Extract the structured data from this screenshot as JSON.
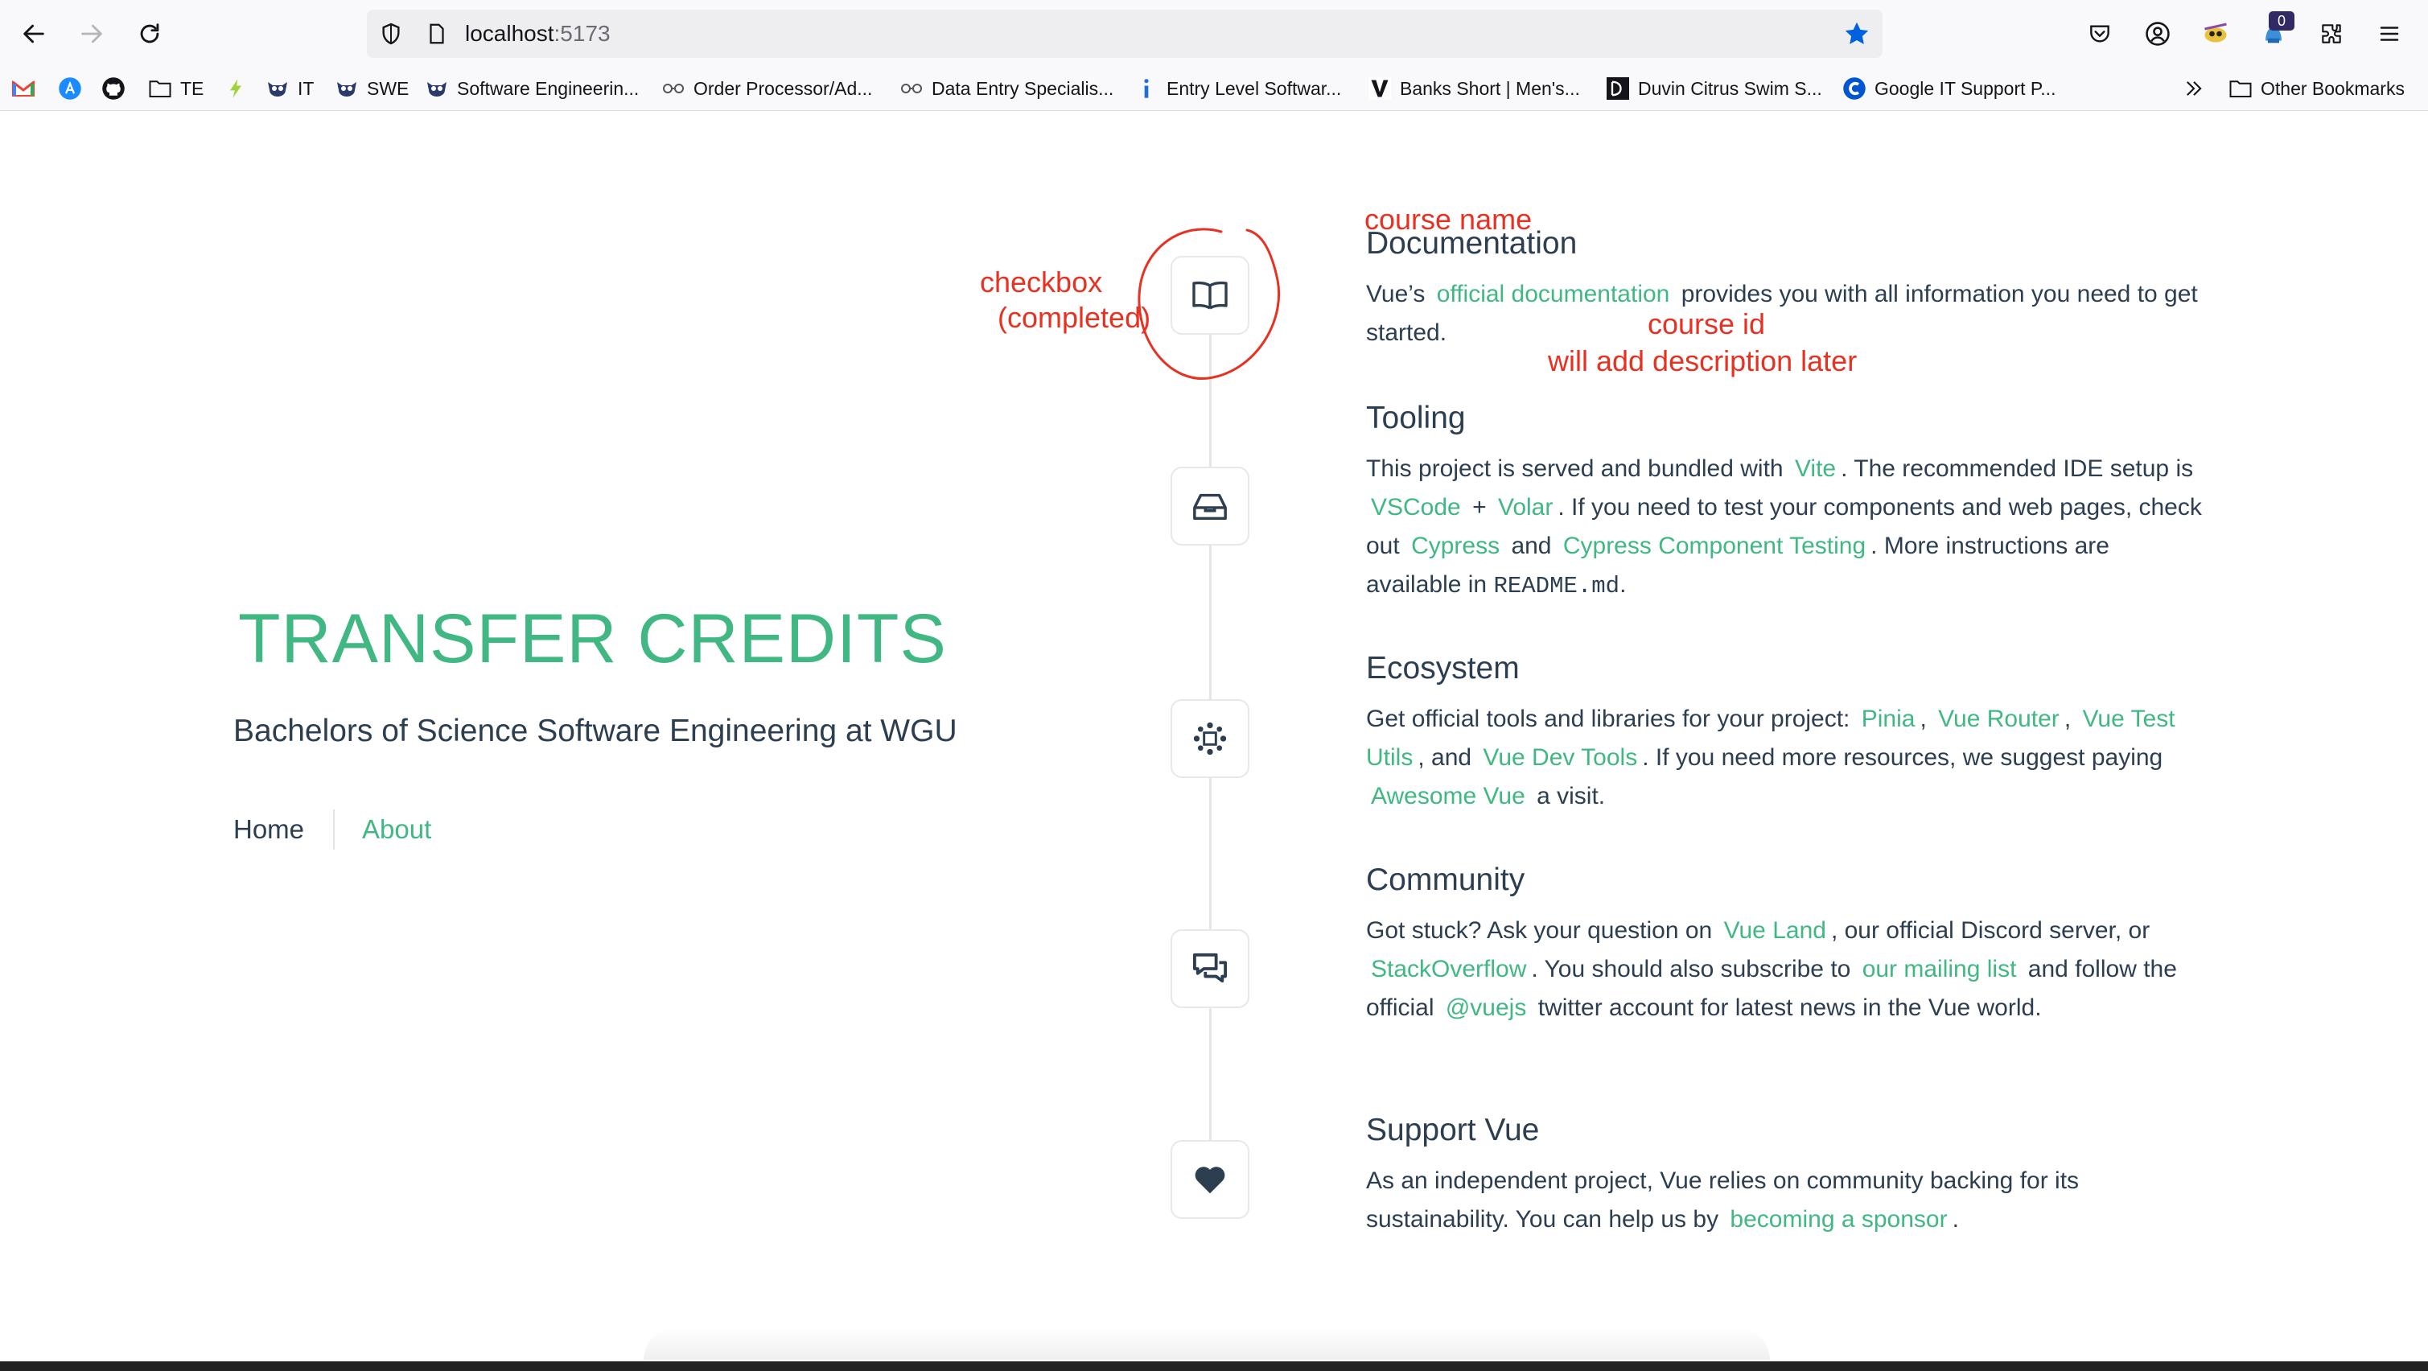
{
  "browser": {
    "url_host": "localhost",
    "url_port": ":5173",
    "extension_badge": "0",
    "bookmarks": [
      {
        "label": "",
        "icon": "gmail-icon"
      },
      {
        "label": "",
        "icon": "app-store-icon"
      },
      {
        "label": "",
        "icon": "github-icon"
      },
      {
        "label": "TE",
        "icon": "folder-icon"
      },
      {
        "label": "",
        "icon": "leaf-icon"
      },
      {
        "label": "IT",
        "icon": "owl-icon"
      },
      {
        "label": "SWE",
        "icon": "owl-icon"
      },
      {
        "label": "Software Engineerin...",
        "icon": "owl-icon"
      },
      {
        "label": "Order Processor/Ad...",
        "icon": "glasses-icon"
      },
      {
        "label": "Data Entry Specialis...",
        "icon": "glasses-icon"
      },
      {
        "label": "Entry Level Softwar...",
        "icon": "info-icon"
      },
      {
        "label": "Banks Short | Men's...",
        "icon": "v-logo-icon"
      },
      {
        "label": "Duvin Citrus Swim S...",
        "icon": "dv-logo-icon"
      },
      {
        "label": "Google IT Support P...",
        "icon": "coursera-icon"
      },
      {
        "label": "Other Bookmarks",
        "icon": "folder-icon"
      }
    ]
  },
  "hero": {
    "title": "TRANSFER CREDITS",
    "subtitle": "Bachelors of Science Software Engineering at WGU",
    "nav": {
      "home": "Home",
      "about": "About"
    }
  },
  "sections": {
    "documentation": {
      "heading": "Documentation",
      "t1": "Vue’s",
      "link1": "official documentation",
      "t2": "provides you with all information you need to get started."
    },
    "tooling": {
      "heading": "Tooling",
      "t1": "This project is served and bundled with",
      "vite": "Vite",
      "t2": ". The recommended IDE setup is",
      "vscode": "VSCode",
      "plus": "+",
      "volar": "Volar",
      "t3": ". If you need to test your components and web pages, check out",
      "cypress": "Cypress",
      "and": "and",
      "cct": "Cypress Component Testing",
      "t4": ". More instructions are available in",
      "readme": "README.md",
      "dot": "."
    },
    "ecosystem": {
      "heading": "Ecosystem",
      "t1": "Get official tools and libraries for your project:",
      "pinia": "Pinia",
      "comma1": ",",
      "router": "Vue Router",
      "comma2": ",",
      "testutils": "Vue Test Utils",
      "t2": ", and",
      "devtools": "Vue Dev Tools",
      "t3": ". If you need more resources, we suggest paying",
      "awesome": "Awesome Vue",
      "t4": "a visit."
    },
    "community": {
      "heading": "Community",
      "t1": "Got stuck? Ask your question on",
      "land": "Vue Land",
      "t2": ", our official Discord server, or",
      "so": "StackOverflow",
      "t3": ". You should also subscribe to",
      "mailing": "our mailing list",
      "t4": "and follow the official",
      "vuejs": "@vuejs",
      "t5": "twitter account for latest news in the Vue world."
    },
    "support": {
      "heading": "Support Vue",
      "t1": "As an independent project, Vue relies on community backing for its sustainability. You can help us by",
      "sponsor": "becoming a sponsor",
      "dot": "."
    }
  },
  "annotations": {
    "course_name": "course name",
    "checkbox": "checkbox",
    "completed": "(completed)",
    "course_id": "course id",
    "description": "will add description later",
    "color": "#e53223"
  },
  "colors": {
    "accent": "#41b883",
    "text": "#2c3e50"
  }
}
